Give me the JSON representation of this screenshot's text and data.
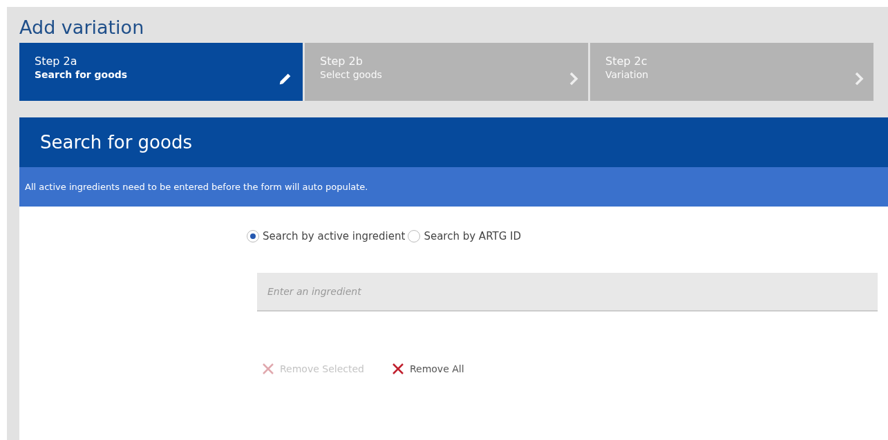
{
  "page_title": "Add variation",
  "steps": [
    {
      "label": "Step 2a",
      "sublabel": "Search for goods",
      "selected": true
    },
    {
      "label": "Step 2b",
      "sublabel": "Select goods",
      "selected": false
    },
    {
      "label": "Step 2c",
      "sublabel": "Variation",
      "selected": false
    }
  ],
  "panel": {
    "title": "Search for goods",
    "info": "All active ingredients need to be entered before the form will auto populate.",
    "search_modes": [
      {
        "label": "Search by active ingredient",
        "selected": true
      },
      {
        "label": "Search by ARTG ID",
        "selected": false
      }
    ],
    "ingredient_field": {
      "placeholder": "Enter an ingredient"
    },
    "actions": [
      {
        "label": "Remove Selected",
        "disabled": true
      },
      {
        "label": "Remove All",
        "disabled": false
      }
    ]
  }
}
